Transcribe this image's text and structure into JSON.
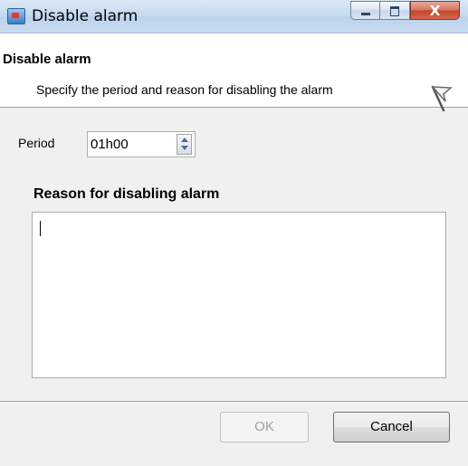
{
  "window": {
    "title": "Disable alarm",
    "close_glyph": "X"
  },
  "header": {
    "title": "Disable alarm",
    "subtitle": "Specify the period and reason for disabling the alarm"
  },
  "form": {
    "period_label": "Period",
    "period_value": "01h00",
    "reason_label": "Reason for disabling alarm",
    "reason_value": ""
  },
  "buttons": {
    "ok_label": "OK",
    "cancel_label": "Cancel"
  },
  "icons": {
    "app": "alarm-window-icon",
    "header": "flag-icon"
  }
}
